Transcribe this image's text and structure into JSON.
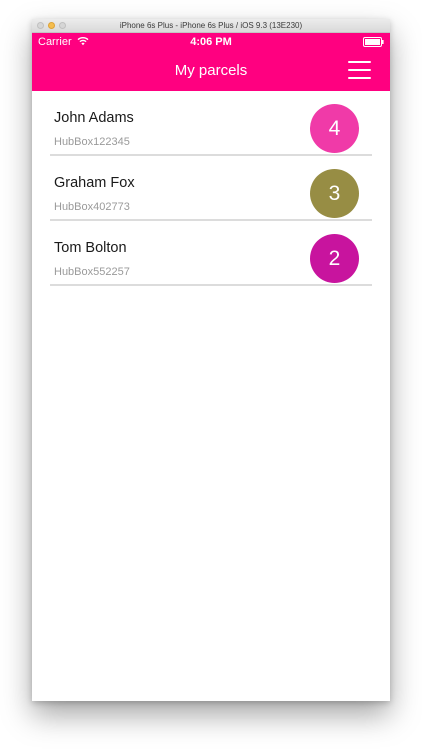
{
  "simulator": {
    "title": "iPhone 6s Plus - iPhone 6s Plus / iOS 9.3 (13E230)"
  },
  "status_bar": {
    "carrier": "Carrier",
    "time": "4:06 PM",
    "wifi_icon": "wifi-icon",
    "battery_icon": "battery-icon"
  },
  "header": {
    "title": "My parcels",
    "menu_icon": "hamburger-menu-icon",
    "background_color": "#ff0080"
  },
  "parcels": [
    {
      "name": "John Adams",
      "hub_id": "HubBox122345",
      "count": "4",
      "badge_color": "#f03aa8"
    },
    {
      "name": "Graham Fox",
      "hub_id": "HubBox402773",
      "count": "3",
      "badge_color": "#978d44"
    },
    {
      "name": "Tom Bolton",
      "hub_id": "HubBox552257",
      "count": "2",
      "badge_color": "#c8149e"
    }
  ]
}
